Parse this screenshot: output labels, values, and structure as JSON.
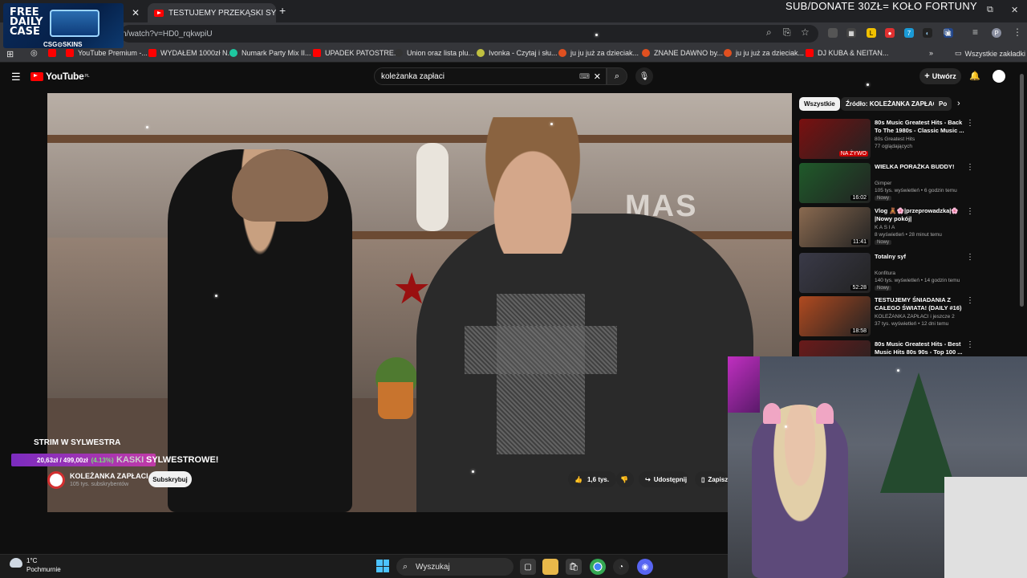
{
  "overlay": {
    "title": "SUB/DONATE 30ZŁ= KOŁO FORTUNY",
    "strim_label": "STRIM W SYLWESTRA",
    "goal_text": "20,63zł / 499,00zł",
    "goal_pct": "(4.13%)",
    "goal_fraction": 0.0413,
    "sponsor": {
      "line1": "FREE",
      "line2": "DAILY",
      "line3": "CASE",
      "brand": "CSG⊙SKINS"
    }
  },
  "browser": {
    "tabs": [
      {
        "label": "TESTUJEMY PRZEKĄSKI SYL",
        "active": true
      }
    ],
    "new_tab": "+",
    "url": "n/watch?v=HD0_rqkwpiU",
    "bookmarks": [
      {
        "label": "YouTube Premium -...",
        "color": "#ff0000"
      },
      {
        "label": "WYDAŁEM 1000zł N...",
        "color": "#ff0000"
      },
      {
        "label": "Numark Party Mix II...",
        "color": "#1ec7a0"
      },
      {
        "label": "UPADEK PATOSTRE...",
        "color": "#ff0000"
      },
      {
        "label": "Union oraz lista plu...",
        "color": "#333333"
      },
      {
        "label": "Ivonka - Czytaj i słu...",
        "color": "#c0c040"
      },
      {
        "label": "ju ju już za dzieciak...",
        "color": "#e05020"
      },
      {
        "label": "ZNANE DAWNO by...",
        "color": "#e05020"
      },
      {
        "label": "ju ju już za dzieciak...",
        "color": "#e05020"
      },
      {
        "label": "DJ KUBA & NEITAN...",
        "color": "#ff0000"
      }
    ],
    "all_bookmarks": "Wszystkie zakładki"
  },
  "youtube": {
    "logo": "YouTube",
    "logo_suffix": "PL",
    "search_value": "koleżanka zapłaci",
    "create_label": "Utwórz",
    "video_title": "SYLWESTROWE!",
    "video_title_prefix": "KASKI",
    "channel_name": "KOLEŻANKA ZAPŁACI",
    "channel_subs": "105 tys. subskrybentów",
    "subscribe_label": "Subskrybuj",
    "likes": "1,6 tys.",
    "share_label": "Udostępnij",
    "save_label": "Zapisz",
    "chips": [
      "Wszystkie",
      "Źródło: KOLEŻANKA ZAPŁACI",
      "Po"
    ],
    "recommendations": [
      {
        "title": "80s Music Greatest Hits - Back To The 1980s - Classic Music ...",
        "channel": "80s Greatest Hits",
        "meta": "77 oglądających",
        "badge": "NA ŻYWO",
        "duration": "",
        "thumb": "#7a1010"
      },
      {
        "title": "WIELKA PORAŻKA BUDDY!",
        "channel": "Gimper",
        "meta": "105 tys. wyświetleń • 6 godzin temu",
        "badge": "Nowy",
        "duration": "16:02",
        "thumb": "#1f5a2a"
      },
      {
        "title": "Vlog 🧸🌸|przeprowadzka|🌸 |Nowy pokój|",
        "channel": "K A S I A",
        "meta": "8 wyświetleń • 28 minut temu",
        "badge": "Nowy",
        "duration": "11:41",
        "thumb": "#8a6a50"
      },
      {
        "title": "Totalny syf",
        "channel": "Konfitura",
        "meta": "140 tys. wyświetleń • 14 godzin temu",
        "badge": "Nowy",
        "duration": "52:28",
        "thumb": "#3a3a48"
      },
      {
        "title": "TESTUJEMY ŚNIADANIA Z CAŁEGO ŚWIATA! (DAILY #16)",
        "channel": "KOLEŻANKA ZAPŁACI i jeszcze 2",
        "meta": "37 tys. wyświetleń • 12 dni temu",
        "badge": "",
        "duration": "18:58",
        "thumb": "#b04a20"
      },
      {
        "title": "80s Music Greatest Hits - Best Music Hits 80s 90s - Top 100 ...",
        "channel": "",
        "meta": "",
        "badge": "",
        "duration": "",
        "thumb": "#6a1a1a"
      }
    ]
  },
  "taskbar": {
    "temperature": "1°C",
    "weather": "Pochmurnie",
    "search_placeholder": "Wyszukaj"
  }
}
